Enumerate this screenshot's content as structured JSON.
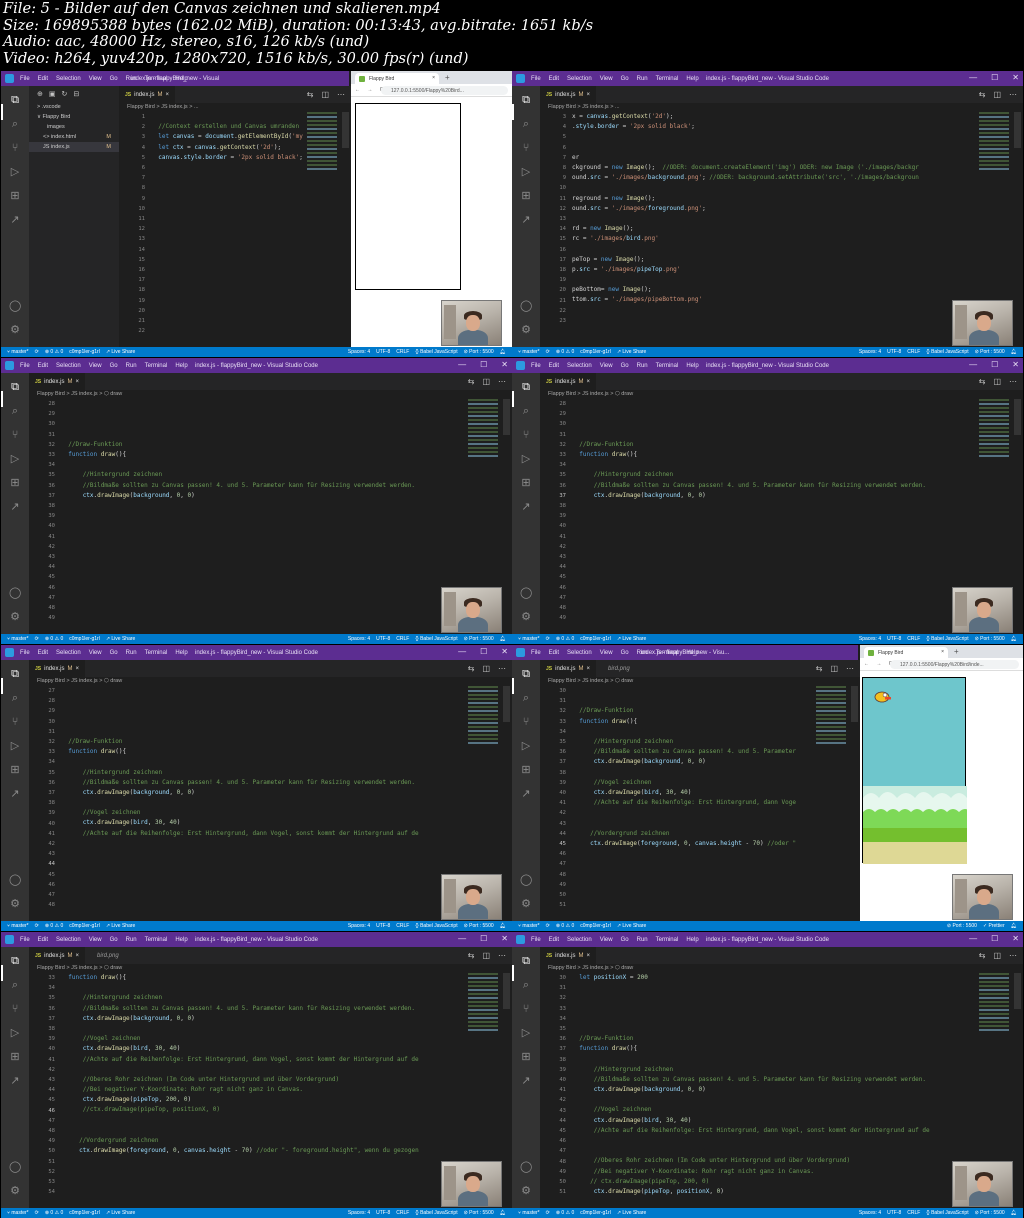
{
  "header": {
    "line1": "File: 5 - Bilder auf den Canvas zeichnen und skalieren.mp4",
    "line2": "Size: 169895388 bytes (162.02 MiB), duration: 00:13:43, avg.bitrate: 1651 kb/s",
    "line3": "Audio: aac, 48000 Hz, stereo, s16, 126 kb/s (und)",
    "line4": "Video: h264, yuv420p, 1280x720, 1516 kb/s, 30.00 fps(r) (und)"
  },
  "vscode": {
    "menu": [
      "File",
      "Edit",
      "Selection",
      "View",
      "Go",
      "Run",
      "Terminal",
      "Help"
    ],
    "window_title": "index.js - flappyBird_new - Visual Studio Code",
    "window_title_short": "index.js - flappyBird_new - Visu...",
    "window_title_a": "index.js - flappyBird_new - Visual",
    "min": "—",
    "max": "☐",
    "close": "✕",
    "tab": {
      "badge": "JS",
      "name": "index.js",
      "mod": "M",
      "close": "×"
    },
    "tab_bird": "bird.png",
    "breadcrumb_draw": "Flappy Bird > JS index.js > ⬡ draw",
    "breadcrumb_root": "Flappy Bird > JS index.js > ...",
    "status": {
      "branch": "⑂ master*",
      "sync": "⟳",
      "problems": "⊗ 0 ⚠ 0",
      "user": "c0mp1ler-g1rl",
      "liveshare": "↗ Live Share",
      "spaces": "Spaces: 4",
      "encoding": "UTF-8",
      "eol": "CRLF",
      "language": "{} Babel JavaScript",
      "port": "⊘ Port : 5500",
      "prettier": "✓ Prettier"
    },
    "explorer": {
      "items": [
        {
          "name": "> .vscode",
          "mark": ""
        },
        {
          "name": "∨ Flappy Bird",
          "mark": ""
        },
        {
          "name": "images",
          "mark": ""
        },
        {
          "name": "<> index.html",
          "mark": "M"
        },
        {
          "name": "JS index.js",
          "mark": "M"
        }
      ]
    }
  },
  "browser": {
    "tab_title": "Flappy Bird",
    "tab_close": "×",
    "plus": "+",
    "nav": "← → C",
    "url_a": "127.0.0.1:5500/Flappy%20Bird...",
    "url_b": "127.0.0.1:5500/Flappy%20Bird/inde..."
  },
  "frames": [
    {
      "gutter": [
        "1",
        "2",
        "3",
        "4",
        "5",
        "6",
        "7",
        "8",
        "9",
        "10",
        "11",
        "12",
        "13",
        "14",
        "15",
        "16",
        "17",
        "18",
        "19",
        "20",
        "21",
        "22"
      ],
      "lines": [
        "",
        "  //Context erstellen und Canvas umranden",
        "  let canvas = document.getElementById('myCanvas');",
        "  let ctx = canvas.getContext('2d');",
        "  canvas.style.border = '2px solid black';",
        "",
        "",
        "",
        "",
        "",
        "",
        "",
        "",
        "",
        "",
        "",
        "",
        "",
        "",
        "",
        "",
        ""
      ]
    },
    {
      "gutter": [
        "3",
        "4",
        "5",
        "6",
        "7",
        "8",
        "9",
        "10",
        "11",
        "12",
        "13",
        "14",
        "15",
        "16",
        "17",
        "18",
        "19",
        "20",
        "21",
        "22",
        "23"
      ],
      "lines": [
        "x = canvas.getContext('2d');",
        ".style.border = '2px solid black';",
        "",
        "",
        "er",
        "ckground = new Image();  //ODER: document.createElement('img') ODER: new Image ('./images/backgr",
        "ound.src = './images/background.png'; //ODER: background.setAttribute('src', './images/backgroun",
        "",
        "reground = new Image();",
        "ound.src = './images/foreground.png';",
        "",
        "rd = new Image();",
        "rc = './images/bird.png'",
        "",
        "peTop = new Image();",
        "p.src = './images/pipeTop.png'",
        "",
        "peBottom= new Image();",
        "ttom.src = './images/pipeBottom.png'",
        "",
        ""
      ]
    },
    {
      "gutter": [
        "28",
        "29",
        "30",
        "31",
        "32",
        "33",
        "34",
        "35",
        "36",
        "37",
        "38",
        "39",
        "40",
        "41",
        "42",
        "43",
        "44",
        "45",
        "46",
        "47",
        "48",
        "49"
      ],
      "lines": [
        "",
        "",
        "",
        "",
        "  //Draw-Funktion",
        "  function draw(){",
        "",
        "      //Hintergrund zeichnen",
        "      //Bildmaße sollten zu Canvas passen! 4. und 5. Parameter kann für Resizing verwendet werden.",
        "      ctx.drawImage(background, 0, 0)",
        "",
        "",
        "",
        "",
        "",
        "",
        "",
        "",
        "",
        "",
        "",
        ""
      ]
    },
    {
      "gutter": [
        "28",
        "29",
        "30",
        "31",
        "32",
        "33",
        "34",
        "35",
        "36",
        "37",
        "38",
        "39",
        "40",
        "41",
        "42",
        "43",
        "44",
        "45",
        "46",
        "47",
        "48",
        "49"
      ],
      "lines": [
        "",
        "",
        "",
        "",
        "  //Draw-Funktion",
        "  function draw(){",
        "",
        "      //Hintergrund zeichnen",
        "      //Bildmaße sollten zu Canvas passen! 4. und 5. Parameter kann für Resizing verwendet werden.",
        "      ctx.drawImage(background, 0, 0)",
        "",
        "",
        "",
        "",
        "",
        "",
        "",
        "",
        "",
        "",
        "",
        ""
      ]
    },
    {
      "gutter": [
        "27",
        "28",
        "29",
        "30",
        "31",
        "32",
        "33",
        "34",
        "35",
        "36",
        "37",
        "38",
        "39",
        "40",
        "41",
        "42",
        "43",
        "44",
        "45",
        "46",
        "47",
        "48"
      ],
      "lines": [
        "",
        "",
        "",
        "",
        "",
        "  //Draw-Funktion",
        "  function draw(){",
        "",
        "      //Hintergrund zeichnen",
        "      //Bildmaße sollten zu Canvas passen! 4. und 5. Parameter kann für Resizing verwendet werden.",
        "      ctx.drawImage(background, 0, 0)",
        "",
        "      //Vogel zeichnen",
        "      ctx.drawImage(bird, 30, 40)",
        "      //Achte auf die Reihenfolge: Erst Hintergrund, dann Vogel, sonst kommt der Hintergrund auf de",
        "",
        "",
        "",
        "",
        "",
        "",
        ""
      ]
    },
    {
      "gutter": [
        "30",
        "31",
        "32",
        "33",
        "34",
        "35",
        "36",
        "37",
        "38",
        "39",
        "40",
        "41",
        "42",
        "43",
        "44",
        "45",
        "46",
        "47",
        "48",
        "49",
        "50",
        "51"
      ],
      "lines": [
        "",
        "",
        "  //Draw-Funktion",
        "  function draw(){",
        "",
        "      //Hintergrund zeichnen",
        "      //Bildmaße sollten zu Canvas passen! 4. und 5. Parameter",
        "      ctx.drawImage(background, 0, 0)",
        "",
        "      //Vogel zeichnen",
        "      ctx.drawImage(bird, 30, 40)",
        "      //Achte auf die Reihenfolge: Erst Hintergrund, dann Voge",
        "",
        "",
        "     //Vordergrund zeichnen",
        "     ctx.drawImage(foreground, 0, canvas.height - 70) //oder \"",
        "",
        "",
        "",
        "",
        "",
        ""
      ]
    },
    {
      "gutter": [
        "33",
        "34",
        "35",
        "36",
        "37",
        "38",
        "39",
        "40",
        "41",
        "42",
        "43",
        "44",
        "45",
        "46",
        "47",
        "48",
        "49",
        "50",
        "51",
        "52",
        "53",
        "54"
      ],
      "lines": [
        "  function draw(){",
        "",
        "      //Hintergrund zeichnen",
        "      //Bildmaße sollten zu Canvas passen! 4. und 5. Parameter kann für Resizing verwendet werden.",
        "      ctx.drawImage(background, 0, 0)",
        "",
        "      //Vogel zeichnen",
        "      ctx.drawImage(bird, 30, 40)",
        "      //Achte auf die Reihenfolge: Erst Hintergrund, dann Vogel, sonst kommt der Hintergrund auf de",
        "",
        "      //Oberes Rohr zeichnen (Im Code unter Hintergrund und über Vordergrund)",
        "      //Bei negativer Y-Koordinate: Rohr ragt nicht ganz in Canvas.",
        "      ctx.drawImage(pipeTop, 200, 0)",
        "      //ctx.drawImage(pipeTop, positionX, 0)",
        "",
        "",
        "     //Vordergrund zeichnen",
        "     ctx.drawImage(foreground, 0, canvas.height - 70) //oder \"- foreground.height\", wenn du gezogen",
        "",
        "",
        "",
        ""
      ]
    },
    {
      "gutter": [
        "30",
        "31",
        "32",
        "33",
        "34",
        "35",
        "36",
        "37",
        "38",
        "39",
        "40",
        "41",
        "42",
        "43",
        "44",
        "45",
        "46",
        "47",
        "48",
        "49",
        "50",
        "51"
      ],
      "lines": [
        "  let positionX = 200",
        "",
        "",
        "",
        "",
        "",
        "  //Draw-Funktion",
        "  function draw(){",
        "",
        "      //Hintergrund zeichnen",
        "      //Bildmaße sollten zu Canvas passen! 4. und 5. Parameter kann für Resizing verwendet werden.",
        "      ctx.drawImage(background, 0, 0)",
        "",
        "      //Vogel zeichnen",
        "      ctx.drawImage(bird, 30, 40)",
        "      //Achte auf die Reihenfolge: Erst Hintergrund, dann Vogel, sonst kommt der Hintergrund auf de",
        "",
        "",
        "      //Oberes Rohr zeichnen (Im Code unter Hintergrund und über Vordergrund)",
        "      //Bei negativer Y-Koordinate: Rohr ragt nicht ganz in Canvas.",
        "     // ctx.drawImage(pipeTop, 200, 0)",
        "      ctx.drawImage(pipeTop, positionX, 0)"
      ]
    }
  ]
}
